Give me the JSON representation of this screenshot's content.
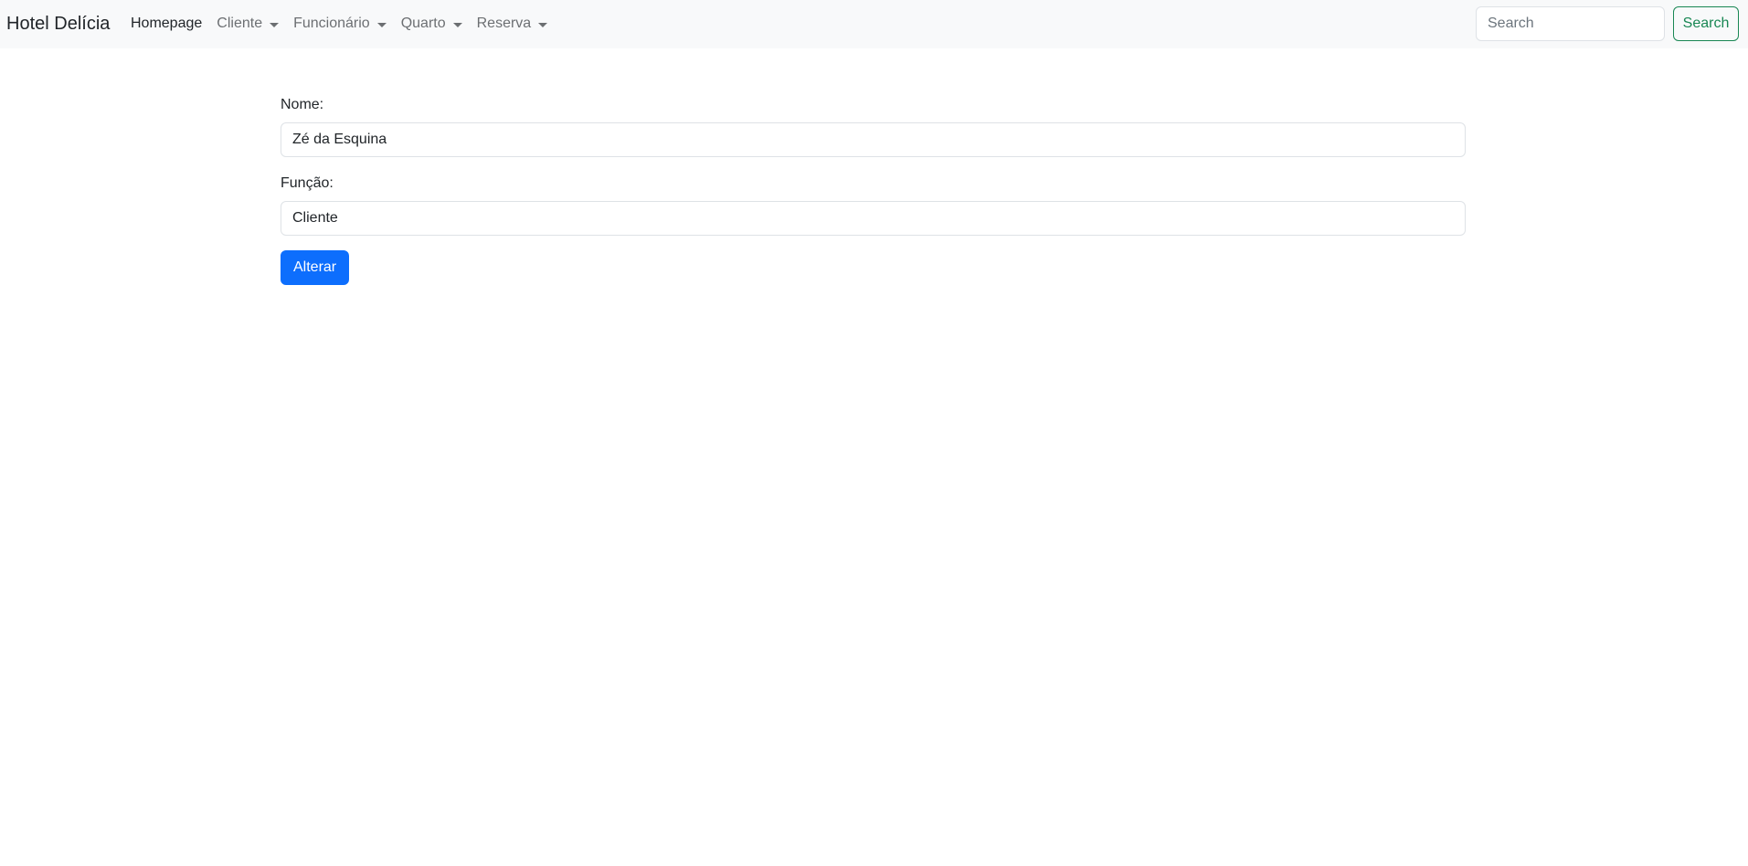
{
  "navbar": {
    "brand": "Hotel Delícia",
    "items": [
      {
        "label": "Homepage",
        "active": true,
        "dropdown": false
      },
      {
        "label": "Cliente",
        "active": false,
        "dropdown": true
      },
      {
        "label": "Funcionário",
        "active": false,
        "dropdown": true
      },
      {
        "label": "Quarto",
        "active": false,
        "dropdown": true
      },
      {
        "label": "Reserva",
        "active": false,
        "dropdown": true
      }
    ],
    "search": {
      "placeholder": "Search",
      "value": "",
      "button_label": "Search"
    }
  },
  "form": {
    "nome": {
      "label": "Nome:",
      "value": "Zé da Esquina"
    },
    "funcao": {
      "label": "Função:",
      "value": "Cliente"
    },
    "submit_label": "Alterar"
  },
  "colors": {
    "navbar_bg": "#f8f9fa",
    "primary": "#0d6efd",
    "success": "#198754"
  }
}
